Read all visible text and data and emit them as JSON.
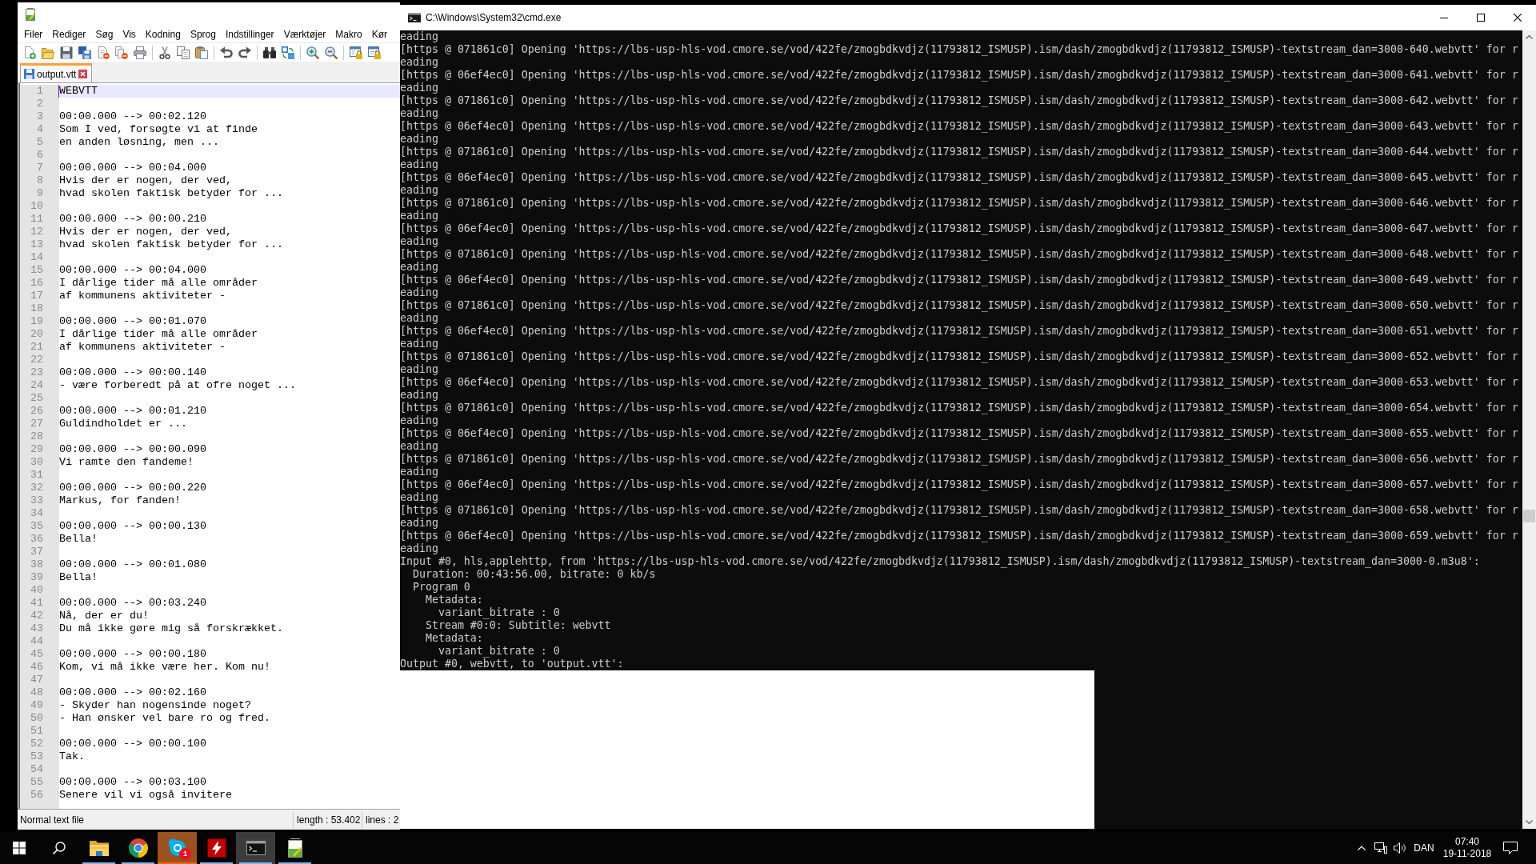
{
  "notepad": {
    "menu": [
      "Filer",
      "Rediger",
      "Søg",
      "Vis",
      "Kodning",
      "Sprog",
      "Indstillinger",
      "Værktøjer",
      "Makro",
      "Kør"
    ],
    "tabs": [
      {
        "label": "output.vtt",
        "selected": true
      }
    ],
    "editor": {
      "lines": [
        {
          "number": "1",
          "text": "WEBVTT",
          "selected": true
        },
        {
          "number": "2",
          "selected": false
        },
        {
          "number": "3",
          "text": "00:00.000 --> 00:02.120",
          "selected": false
        },
        {
          "number": "4",
          "text": "Som I ved, forsøgte vi at finde",
          "selected": false
        },
        {
          "number": "5",
          "text": "en anden løsning, men ...",
          "selected": false
        },
        {
          "number": "6",
          "selected": false
        },
        {
          "number": "7",
          "text": "00:00.000 --> 00:04.000",
          "selected": false
        },
        {
          "number": "8",
          "text": "Hvis der er nogen, der ved,",
          "selected": false
        },
        {
          "number": "9",
          "text": "hvad skolen faktisk betyder for ...",
          "selected": false
        },
        {
          "number": "10",
          "selected": false
        },
        {
          "number": "11",
          "text": "00:00.000 --> 00:00.210",
          "selected": false
        },
        {
          "number": "12",
          "text": "Hvis der er nogen, der ved,",
          "selected": false
        },
        {
          "number": "13",
          "text": "hvad skolen faktisk betyder for ...",
          "selected": false
        },
        {
          "number": "14",
          "selected": false
        },
        {
          "number": "15",
          "text": "00:00.000 --> 00:04.000",
          "selected": false
        },
        {
          "number": "16",
          "text": "I dårlige tider må alle områder",
          "selected": false
        },
        {
          "number": "17",
          "text": "af kommunens aktiviteter -",
          "selected": false
        },
        {
          "number": "18",
          "selected": false
        },
        {
          "number": "19",
          "text": "00:00.000 --> 00:01.070",
          "selected": false
        },
        {
          "number": "20",
          "text": "I dårlige tider må alle områder",
          "selected": false
        },
        {
          "number": "21",
          "text": "af kommunens aktiviteter -",
          "selected": false
        },
        {
          "number": "22",
          "selected": false
        },
        {
          "number": "23",
          "text": "00:00.000 --> 00:00.140",
          "selected": false
        },
        {
          "number": "24",
          "text": "- være forberedt på at ofre noget ...",
          "selected": false
        },
        {
          "number": "25",
          "selected": false
        },
        {
          "number": "26",
          "text": "00:00.000 --> 00:01.210",
          "selected": false
        },
        {
          "number": "27",
          "text": "Guldindholdet er ...",
          "selected": false
        },
        {
          "number": "28",
          "selected": false
        },
        {
          "number": "29",
          "text": "00:00.000 --> 00:00.090",
          "selected": false
        },
        {
          "number": "30",
          "text": "Vi ramte den fandeme!",
          "selected": false
        },
        {
          "number": "31",
          "selected": false
        },
        {
          "number": "32",
          "text": "00:00.000 --> 00:00.220",
          "selected": false
        },
        {
          "number": "33",
          "text": "Markus, for fanden!",
          "selected": false
        },
        {
          "number": "34",
          "selected": false
        },
        {
          "number": "35",
          "text": "00:00.000 --> 00:00.130",
          "selected": false
        },
        {
          "number": "36",
          "text": "Bella!",
          "selected": false
        },
        {
          "number": "37",
          "selected": false
        },
        {
          "number": "38",
          "text": "00:00.000 --> 00:01.080",
          "selected": false
        },
        {
          "number": "39",
          "text": "Bella!",
          "selected": false
        },
        {
          "number": "40",
          "selected": false
        },
        {
          "number": "41",
          "text": "00:00.000 --> 00:03.240",
          "selected": false
        },
        {
          "number": "42",
          "text": "Nå, der er du!",
          "selected": false
        },
        {
          "number": "43",
          "text": "Du må ikke gøre mig så forskrækket.",
          "selected": false
        },
        {
          "number": "44",
          "selected": false
        },
        {
          "number": "45",
          "text": "00:00.000 --> 00:00.180",
          "selected": false
        },
        {
          "number": "46",
          "text": "Kom, vi må ikke være her. Kom nu!",
          "selected": false
        },
        {
          "number": "47",
          "selected": false
        },
        {
          "number": "48",
          "text": "00:00.000 --> 00:02.160",
          "selected": false
        },
        {
          "number": "49",
          "text": "- Skyder han nogensinde noget?",
          "selected": false
        },
        {
          "number": "50",
          "text": "- Han ønsker vel bare ro og fred.",
          "selected": false
        },
        {
          "number": "51",
          "selected": false
        },
        {
          "number": "52",
          "text": "00:00.000 --> 00:00.100",
          "selected": false
        },
        {
          "number": "53",
          "text": "Tak.",
          "selected": false
        },
        {
          "number": "54",
          "selected": false
        },
        {
          "number": "55",
          "text": "00:00.000 --> 00:03.100",
          "selected": false
        },
        {
          "number": "56",
          "text": "Senere vil vi også invitere",
          "selected": false
        }
      ]
    },
    "status_bar": {
      "file_type": "Normal text file",
      "length": "length : 53.402",
      "lines": "lines : 2"
    }
  },
  "console": {
    "title": "C:\\Windows\\System32\\cmd.exe",
    "lines": [
      "eading",
      "[https @ 071861c0] Opening 'https://lbs-usp-hls-vod.cmore.se/vod/422fe/zmogbdkvdjz(11793812_ISMUSP).ism/dash/zmogbdkvdjz(11793812_ISMUSP)-textstream_dan=3000-640.webvtt' for r",
      "eading",
      "[https @ 06ef4ec0] Opening 'https://lbs-usp-hls-vod.cmore.se/vod/422fe/zmogbdkvdjz(11793812_ISMUSP).ism/dash/zmogbdkvdjz(11793812_ISMUSP)-textstream_dan=3000-641.webvtt' for r",
      "eading",
      "[https @ 071861c0] Opening 'https://lbs-usp-hls-vod.cmore.se/vod/422fe/zmogbdkvdjz(11793812_ISMUSP).ism/dash/zmogbdkvdjz(11793812_ISMUSP)-textstream_dan=3000-642.webvtt' for r",
      "eading",
      "[https @ 06ef4ec0] Opening 'https://lbs-usp-hls-vod.cmore.se/vod/422fe/zmogbdkvdjz(11793812_ISMUSP).ism/dash/zmogbdkvdjz(11793812_ISMUSP)-textstream_dan=3000-643.webvtt' for r",
      "eading",
      "[https @ 071861c0] Opening 'https://lbs-usp-hls-vod.cmore.se/vod/422fe/zmogbdkvdjz(11793812_ISMUSP).ism/dash/zmogbdkvdjz(11793812_ISMUSP)-textstream_dan=3000-644.webvtt' for r",
      "eading",
      "[https @ 06ef4ec0] Opening 'https://lbs-usp-hls-vod.cmore.se/vod/422fe/zmogbdkvdjz(11793812_ISMUSP).ism/dash/zmogbdkvdjz(11793812_ISMUSP)-textstream_dan=3000-645.webvtt' for r",
      "eading",
      "[https @ 071861c0] Opening 'https://lbs-usp-hls-vod.cmore.se/vod/422fe/zmogbdkvdjz(11793812_ISMUSP).ism/dash/zmogbdkvdjz(11793812_ISMUSP)-textstream_dan=3000-646.webvtt' for r",
      "eading",
      "[https @ 06ef4ec0] Opening 'https://lbs-usp-hls-vod.cmore.se/vod/422fe/zmogbdkvdjz(11793812_ISMUSP).ism/dash/zmogbdkvdjz(11793812_ISMUSP)-textstream_dan=3000-647.webvtt' for r",
      "eading",
      "[https @ 071861c0] Opening 'https://lbs-usp-hls-vod.cmore.se/vod/422fe/zmogbdkvdjz(11793812_ISMUSP).ism/dash/zmogbdkvdjz(11793812_ISMUSP)-textstream_dan=3000-648.webvtt' for r",
      "eading",
      "[https @ 06ef4ec0] Opening 'https://lbs-usp-hls-vod.cmore.se/vod/422fe/zmogbdkvdjz(11793812_ISMUSP).ism/dash/zmogbdkvdjz(11793812_ISMUSP)-textstream_dan=3000-649.webvtt' for r",
      "eading",
      "[https @ 071861c0] Opening 'https://lbs-usp-hls-vod.cmore.se/vod/422fe/zmogbdkvdjz(11793812_ISMUSP).ism/dash/zmogbdkvdjz(11793812_ISMUSP)-textstream_dan=3000-650.webvtt' for r",
      "eading",
      "[https @ 06ef4ec0] Opening 'https://lbs-usp-hls-vod.cmore.se/vod/422fe/zmogbdkvdjz(11793812_ISMUSP).ism/dash/zmogbdkvdjz(11793812_ISMUSP)-textstream_dan=3000-651.webvtt' for r",
      "eading",
      "[https @ 071861c0] Opening 'https://lbs-usp-hls-vod.cmore.se/vod/422fe/zmogbdkvdjz(11793812_ISMUSP).ism/dash/zmogbdkvdjz(11793812_ISMUSP)-textstream_dan=3000-652.webvtt' for r",
      "eading",
      "[https @ 06ef4ec0] Opening 'https://lbs-usp-hls-vod.cmore.se/vod/422fe/zmogbdkvdjz(11793812_ISMUSP).ism/dash/zmogbdkvdjz(11793812_ISMUSP)-textstream_dan=3000-653.webvtt' for r",
      "eading",
      "[https @ 071861c0] Opening 'https://lbs-usp-hls-vod.cmore.se/vod/422fe/zmogbdkvdjz(11793812_ISMUSP).ism/dash/zmogbdkvdjz(11793812_ISMUSP)-textstream_dan=3000-654.webvtt' for r",
      "eading",
      "[https @ 06ef4ec0] Opening 'https://lbs-usp-hls-vod.cmore.se/vod/422fe/zmogbdkvdjz(11793812_ISMUSP).ism/dash/zmogbdkvdjz(11793812_ISMUSP)-textstream_dan=3000-655.webvtt' for r",
      "eading",
      "[https @ 071861c0] Opening 'https://lbs-usp-hls-vod.cmore.se/vod/422fe/zmogbdkvdjz(11793812_ISMUSP).ism/dash/zmogbdkvdjz(11793812_ISMUSP)-textstream_dan=3000-656.webvtt' for r",
      "eading",
      "[https @ 06ef4ec0] Opening 'https://lbs-usp-hls-vod.cmore.se/vod/422fe/zmogbdkvdjz(11793812_ISMUSP).ism/dash/zmogbdkvdjz(11793812_ISMUSP)-textstream_dan=3000-657.webvtt' for r",
      "eading",
      "[https @ 071861c0] Opening 'https://lbs-usp-hls-vod.cmore.se/vod/422fe/zmogbdkvdjz(11793812_ISMUSP).ism/dash/zmogbdkvdjz(11793812_ISMUSP)-textstream_dan=3000-658.webvtt' for r",
      "eading",
      "[https @ 06ef4ec0] Opening 'https://lbs-usp-hls-vod.cmore.se/vod/422fe/zmogbdkvdjz(11793812_ISMUSP).ism/dash/zmogbdkvdjz(11793812_ISMUSP)-textstream_dan=3000-659.webvtt' for r",
      "eading",
      "Input #0, hls,applehttp, from 'https://lbs-usp-hls-vod.cmore.se/vod/422fe/zmogbdkvdjz(11793812_ISMUSP).ism/dash/zmogbdkvdjz(11793812_ISMUSP)-textstream_dan=3000-0.m3u8':",
      "  Duration: 00:43:56.00, bitrate: 0 kb/s",
      "  Program 0",
      "    Metadata:",
      "      variant_bitrate : 0",
      "    Stream #0:0: Subtitle: webvtt",
      "    Metadata:",
      "      variant_bitrate : 0",
      "Output #0, webvtt, to 'output.vtt':"
    ]
  },
  "taskbar": {
    "apps": [
      {
        "kind": "explorer",
        "running": true,
        "selected": false,
        "flashing": false
      },
      {
        "kind": "browser",
        "running": true,
        "selected": false,
        "flashing": false
      },
      {
        "kind": "chat",
        "running": true,
        "selected": false,
        "flashing": true,
        "badge": "1"
      },
      {
        "kind": "ftp",
        "running": true,
        "selected": false,
        "flashing": false
      },
      {
        "kind": "terminal",
        "running": true,
        "selected": true,
        "flashing": false
      },
      {
        "kind": "editor",
        "running": true,
        "selected": false,
        "flashing": false
      }
    ],
    "tray": {
      "language": "DAN",
      "time": "07:40",
      "date": "19-11-2018"
    }
  }
}
